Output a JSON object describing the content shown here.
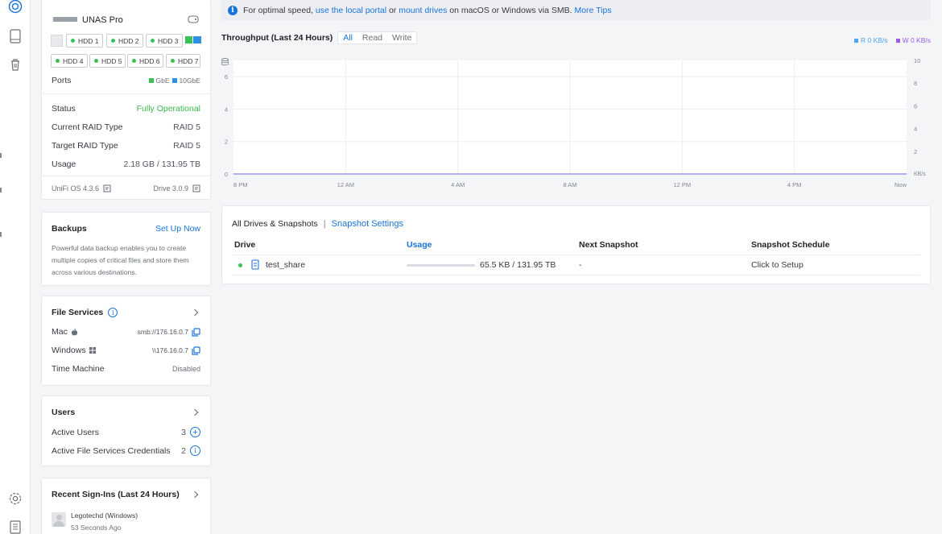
{
  "device": {
    "name": "UNAS Pro",
    "hdds": [
      "HDD 1",
      "HDD 2",
      "HDD 3",
      "HDD 4",
      "HDD 5",
      "HDD 6",
      "HDD 7"
    ],
    "ports_label": "Ports",
    "port_legend": [
      "GbE",
      "10GbE"
    ],
    "status_label": "Status",
    "status_value": "Fully Operational",
    "current_raid_label": "Current RAID Type",
    "current_raid_value": "RAID 5",
    "target_raid_label": "Target RAID Type",
    "target_raid_value": "RAID 5",
    "usage_label": "Usage",
    "usage_value": "2.18 GB / 131.95 TB",
    "os_version": "UniFi OS 4.3.6",
    "drive_version": "Drive 3.0.9"
  },
  "backups": {
    "title": "Backups",
    "action": "Set Up Now",
    "description": "Powerful data backup enables you to create multiple copies of critical files and store them across various destinations."
  },
  "file_services": {
    "title": "File Services",
    "mac_label": "Mac",
    "mac_value": "smb://176.16.0.7",
    "windows_label": "Windows",
    "windows_value": "\\\\176.16.0.7",
    "time_machine_label": "Time Machine",
    "time_machine_value": "Disabled"
  },
  "users": {
    "title": "Users",
    "active_users_label": "Active Users",
    "active_users_value": "3",
    "credentials_label": "Active File Services Credentials",
    "credentials_value": "2"
  },
  "recent_signins": {
    "title": "Recent Sign-Ins (Last 24 Hours)",
    "entries": [
      {
        "name": "Legotechd (Windows)",
        "time": "53 Seconds Ago"
      }
    ]
  },
  "banner": {
    "prefix": "For optimal speed,",
    "link1": "use the local portal",
    "mid": "or",
    "link2": "mount drives",
    "suffix": "on macOS or Windows via SMB.",
    "link3": "More Tips"
  },
  "throughput": {
    "title": "Throughput (Last 24 Hours)",
    "tabs": [
      "All",
      "Read",
      "Write"
    ],
    "legend_read": "R 0 KB/s",
    "legend_write": "W 0 KB/s",
    "left_ticks": [
      "6",
      "4",
      "2",
      "0"
    ],
    "right_ticks": [
      "10",
      "8",
      "6",
      "4",
      "2",
      "KB/s"
    ],
    "x_ticks": [
      "8 PM",
      "12 AM",
      "4 AM",
      "8 AM",
      "12 PM",
      "4 PM",
      "Now"
    ],
    "colors": {
      "read": "#4aa3f0",
      "write": "#9b5ce0",
      "line": "#b9a6ec"
    }
  },
  "chart_data": {
    "type": "line",
    "title": "Throughput (Last 24 Hours)",
    "x": [
      "8 PM",
      "12 AM",
      "4 AM",
      "8 AM",
      "12 PM",
      "4 PM",
      "Now"
    ],
    "series": [
      {
        "name": "R",
        "values": [
          0,
          0,
          0,
          0,
          0,
          0,
          0
        ]
      },
      {
        "name": "W",
        "values": [
          0,
          0,
          0,
          0,
          0,
          0,
          0
        ]
      }
    ],
    "ylim_left": [
      0,
      7
    ],
    "ylim_right": [
      0,
      10
    ],
    "yunit_right": "KB/s",
    "grid": true
  },
  "drives": {
    "title": "All Drives & Snapshots",
    "separator": "|",
    "settings_link": "Snapshot Settings",
    "headers": [
      "Drive",
      "Usage",
      "Next Snapshot",
      "Snapshot Schedule"
    ],
    "rows": [
      {
        "name": "test_share",
        "usage": "65.5 KB / 131.95 TB",
        "usage_fraction": 0.0,
        "next_snapshot": "-",
        "schedule": "Click to Setup"
      }
    ]
  }
}
